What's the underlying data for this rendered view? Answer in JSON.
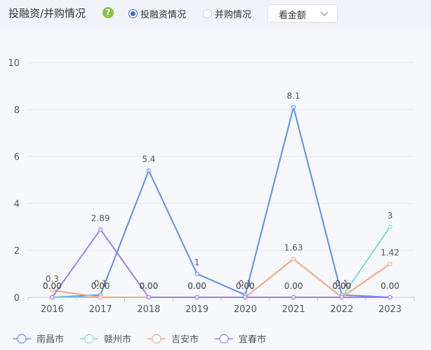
{
  "header": {
    "title": "投融资/并购情况",
    "help_icon": "question-icon",
    "radio_options": [
      {
        "label": "投融资情况",
        "selected": true
      },
      {
        "label": "并购情况",
        "selected": false
      }
    ],
    "select_value": "看金额",
    "accent_color": "#3a6fd8"
  },
  "chart_data": {
    "type": "line",
    "x": [
      "2016",
      "2017",
      "2018",
      "2019",
      "2020",
      "2021",
      "2022",
      "2023"
    ],
    "ylim": [
      0,
      10
    ],
    "yticks": [
      0,
      2,
      4,
      6,
      8,
      10
    ],
    "grid": true,
    "legend_position": "bottom-left",
    "series": [
      {
        "name": "南昌市",
        "color": "#5b8ff9",
        "values": [
          0,
          0.1,
          5.4,
          1,
          0.1,
          8.1,
          0.1,
          0
        ],
        "labels": [
          "0.00",
          "0.1",
          "5.4",
          "1",
          "0.1",
          "8.1",
          "0.1",
          "0.00"
        ]
      },
      {
        "name": "赣州市",
        "color": "#7fdcc6",
        "values": [
          0,
          0,
          0,
          0,
          0,
          0,
          0,
          3
        ],
        "labels": [
          "0.00",
          "0.00",
          "0.00",
          "0.00",
          "0.00",
          "0.00",
          "0.00",
          "3"
        ]
      },
      {
        "name": "吉安市",
        "color": "#f4a582",
        "values": [
          0.3,
          0,
          0,
          0,
          0,
          1.63,
          0,
          1.42
        ],
        "labels": [
          "0.3",
          "0.00",
          "0.00",
          "0.00",
          "0.00",
          "1.63",
          "0.00",
          "1.42"
        ]
      },
      {
        "name": "宜春市",
        "color": "#9a7ff0",
        "values": [
          0,
          2.89,
          0,
          0,
          0,
          0,
          0,
          0
        ],
        "labels": [
          "0.00",
          "2.89",
          "0.00",
          "0.00",
          "0.00",
          "0.00",
          "0.00",
          "0.00"
        ]
      }
    ]
  }
}
